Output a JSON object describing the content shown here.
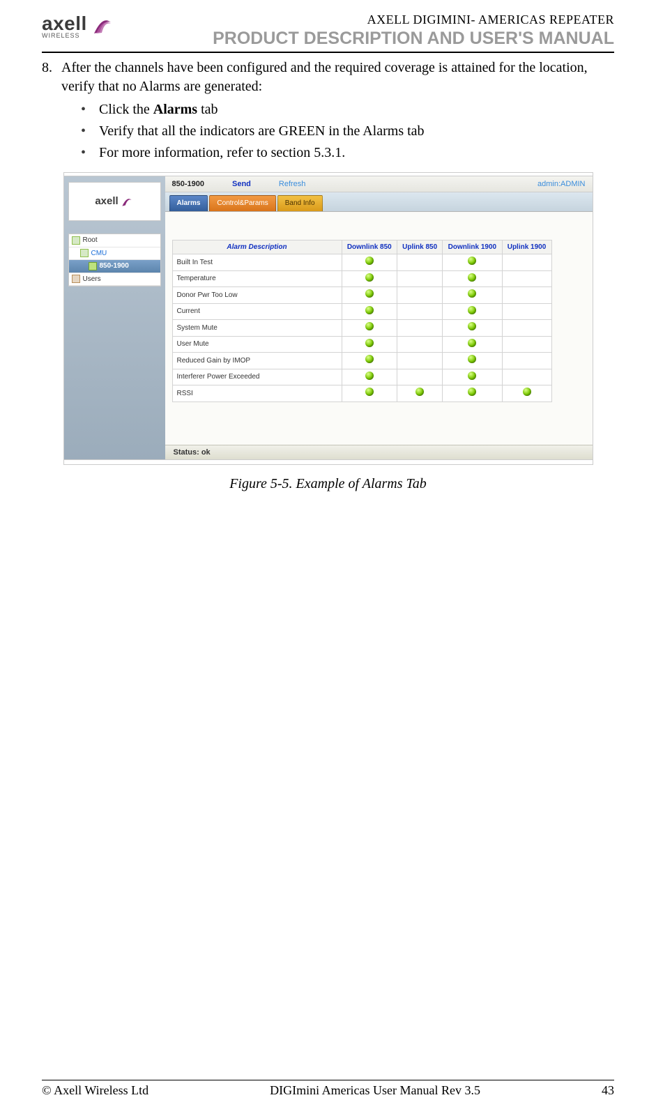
{
  "header": {
    "product_line1": "AXELL DIGIMINI- AMERICAS REPEATER",
    "product_line2": "PRODUCT DESCRIPTION AND USER'S MANUAL",
    "logo_word": "axell",
    "logo_sub": "WIRELESS"
  },
  "step": {
    "num": "8.",
    "text_a": "After the channels have been configured and the required coverage is attained for the location, verify that no Alarms are generated:",
    "b1_pre": "Click the ",
    "b1_bold": "Alarms",
    "b1_post": " tab",
    "b2": "Verify that all the indicators are GREEN in the Alarms tab",
    "b3": "For more information, refer to section 5.3.1."
  },
  "shot": {
    "crumb_title": "850-1900",
    "crumb_send": "Send",
    "crumb_refresh": "Refresh",
    "crumb_admin": "admin:ADMIN",
    "tabs": {
      "alarms": "Alarms",
      "ctrl": "Control&Params",
      "band": "Band Info"
    },
    "tree": {
      "root": "Root",
      "cmu": "CMU",
      "band": "850-1900",
      "users": "Users"
    },
    "table": {
      "h_desc": "Alarm Description",
      "h_dl850": "Downlink 850",
      "h_ul850": "Uplink 850",
      "h_dl1900": "Downlink 1900",
      "h_ul1900": "Uplink 1900",
      "rows": [
        {
          "desc": "Built In Test",
          "dl850": true,
          "ul850": false,
          "dl1900": true,
          "ul1900": false
        },
        {
          "desc": "Temperature",
          "dl850": true,
          "ul850": false,
          "dl1900": true,
          "ul1900": false
        },
        {
          "desc": "Donor Pwr Too Low",
          "dl850": true,
          "ul850": false,
          "dl1900": true,
          "ul1900": false
        },
        {
          "desc": "Current",
          "dl850": true,
          "ul850": false,
          "dl1900": true,
          "ul1900": false
        },
        {
          "desc": "System Mute",
          "dl850": true,
          "ul850": false,
          "dl1900": true,
          "ul1900": false
        },
        {
          "desc": "User Mute",
          "dl850": true,
          "ul850": false,
          "dl1900": true,
          "ul1900": false
        },
        {
          "desc": "Reduced Gain by IMOP",
          "dl850": true,
          "ul850": false,
          "dl1900": true,
          "ul1900": false
        },
        {
          "desc": "Interferer Power Exceeded",
          "dl850": true,
          "ul850": false,
          "dl1900": true,
          "ul1900": false
        },
        {
          "desc": "RSSI",
          "dl850": true,
          "ul850": true,
          "dl1900": true,
          "ul1900": true
        }
      ]
    },
    "status": "Status: ok"
  },
  "figure_caption": "Figure 5-5. Example of Alarms Tab",
  "footer": {
    "left": "© Axell Wireless Ltd",
    "center": "DIGImini Americas User Manual Rev 3.5",
    "right": "43"
  }
}
